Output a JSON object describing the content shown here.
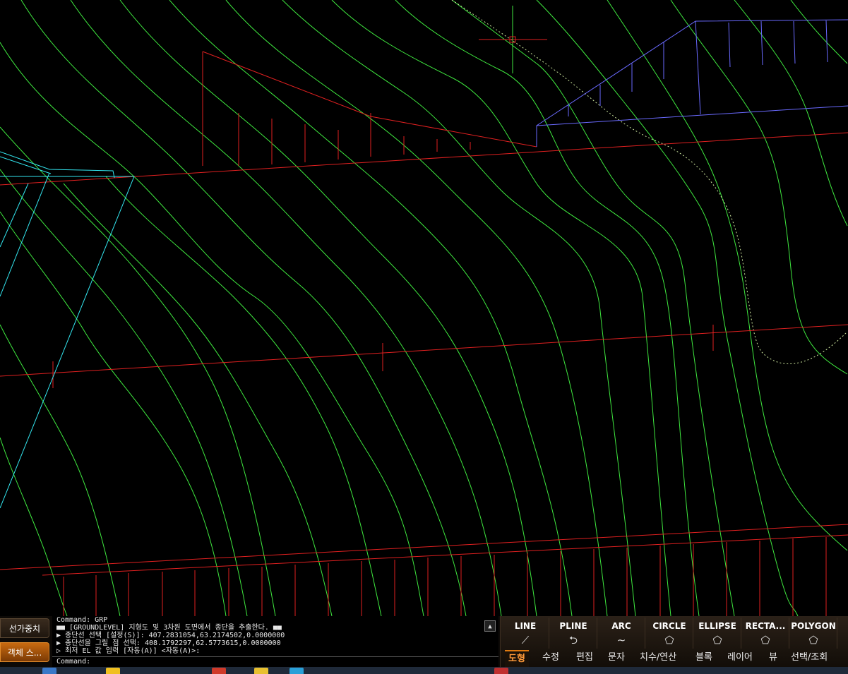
{
  "side_buttons": {
    "line_weight": "선가중치",
    "object_snap": "객체 스..."
  },
  "command_line": {
    "lines": [
      "Command: GRP",
      "■■ [GROUNDLEVEL] 지형도 및 3차원 도면에서 종단을 추출한다. ■■",
      "▶ 종단선 선택 [설정(S)]: 407.2831054,63.2174502,0.0000000",
      "▶ 종단선을 그릴 점 선택: 408.1792297,62.5773615,0.0000000",
      "▷ 최저 EL 값 입력 [자동(A)] <자동(A)>:"
    ],
    "prompt": "Command:",
    "scroll_up_icon": "▲"
  },
  "ribbon": {
    "tools": [
      {
        "label": "LINE",
        "icon": "line-icon",
        "glyph": "⟋"
      },
      {
        "label": "PLINE",
        "icon": "pline-icon",
        "glyph": "⮌"
      },
      {
        "label": "ARC",
        "icon": "arc-icon",
        "glyph": "∼"
      },
      {
        "label": "CIRCLE",
        "icon": "circle-icon",
        "glyph": "⬠"
      },
      {
        "label": "ELLIPSE",
        "icon": "ellipse-icon",
        "glyph": "⬠"
      },
      {
        "label": "RECTA...",
        "icon": "rectangle-icon",
        "glyph": "⬠"
      },
      {
        "label": "POLYGON",
        "icon": "polygon-icon",
        "glyph": "⬠"
      }
    ],
    "tabs": [
      "도형",
      "수정",
      "편집",
      "문자",
      "치수/연산",
      "블록",
      "레이어",
      "뷰",
      "선택/조회"
    ],
    "active_tab": "도형"
  },
  "colors": {
    "background": "#000000",
    "contour": "#3fe93f",
    "profile": "#e02020",
    "structure": "#6a6aff",
    "cyan": "#33e6f0",
    "accent": "#e07a10"
  }
}
